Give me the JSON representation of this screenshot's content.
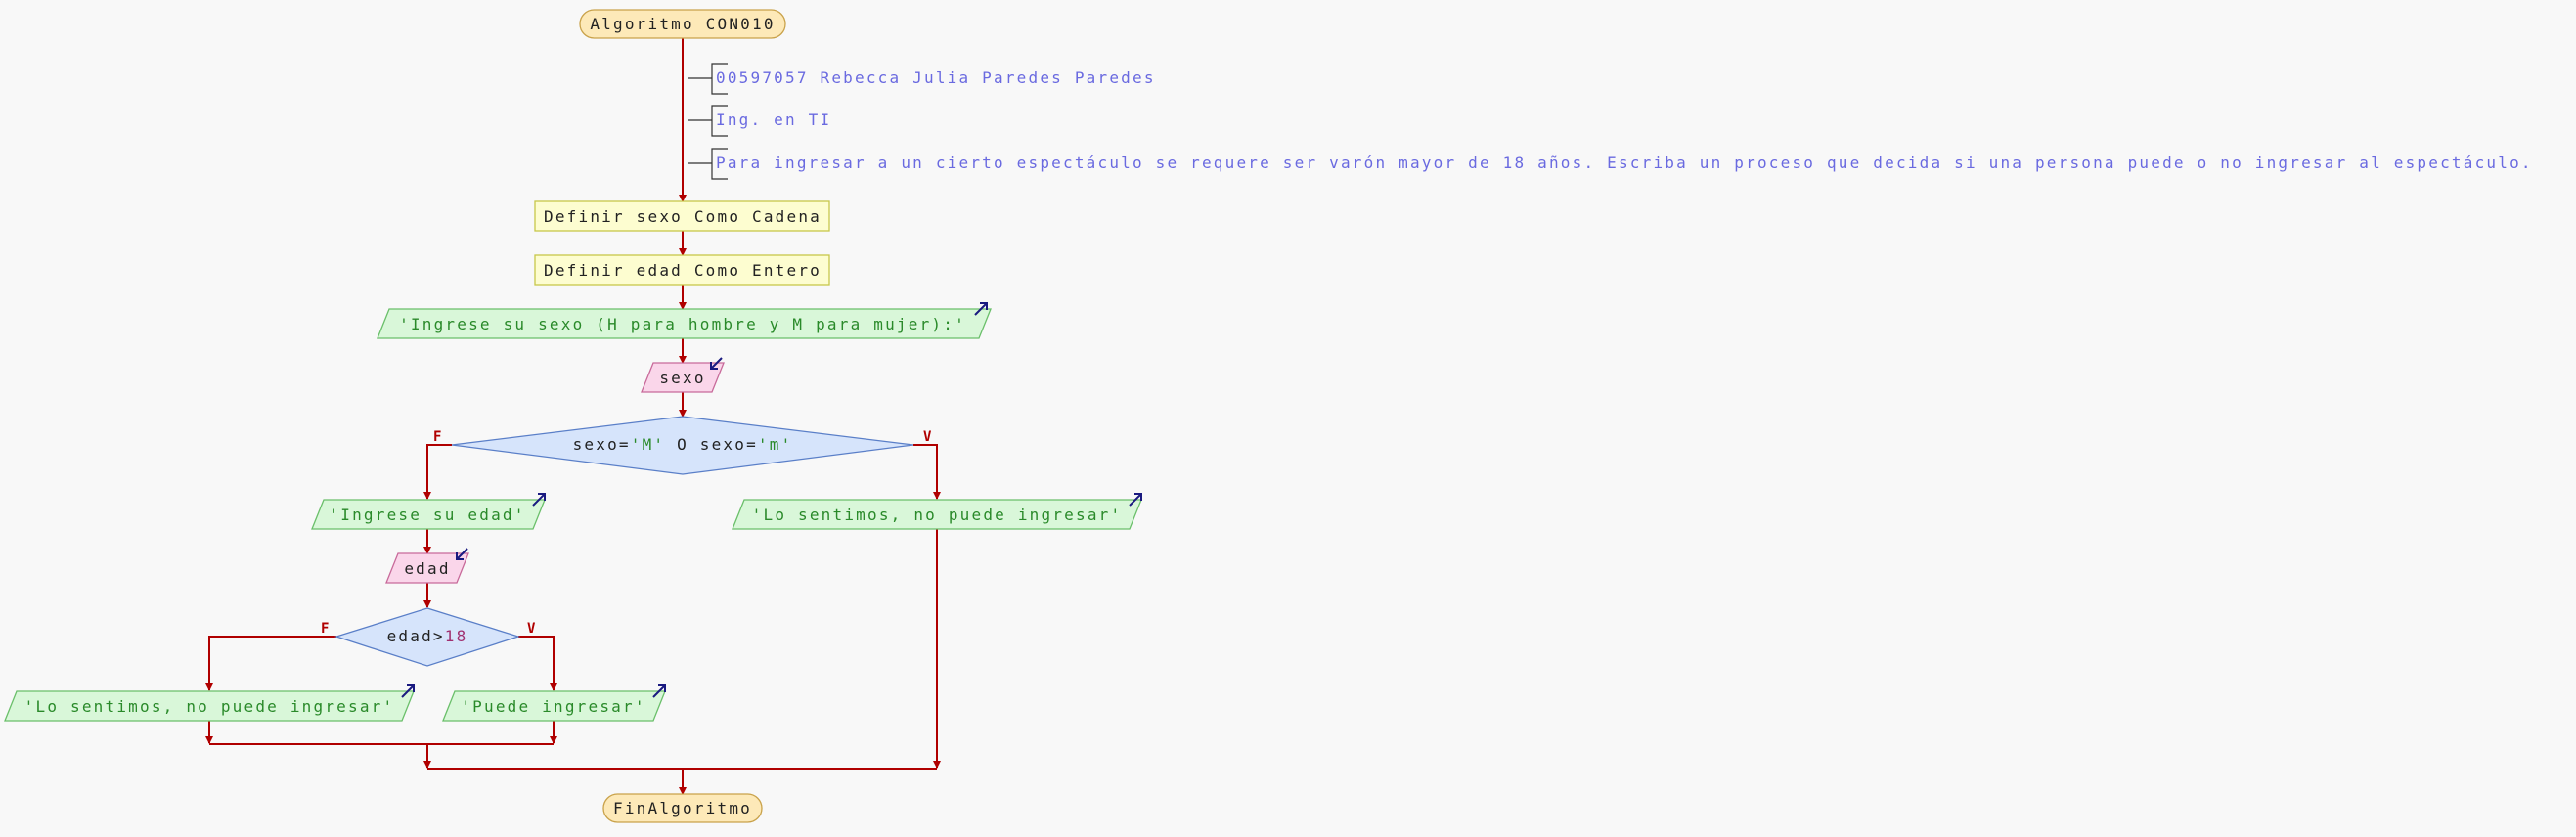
{
  "algorithm": {
    "start": "Algoritmo CON010",
    "end": "FinAlgoritmo"
  },
  "comments": [
    "00597057 Rebecca Julia Paredes Paredes",
    "Ing. en TI",
    "Para ingresar a un cierto espectáculo se requere ser varón mayor de 18 años. Escriba un proceso que decida si una persona puede o no ingresar al espectáculo."
  ],
  "definitions": [
    "Definir sexo Como Cadena",
    "Definir edad Como Entero"
  ],
  "io": {
    "prompt_sexo": "'Ingrese su sexo (H para hombre y M para mujer):'",
    "read_sexo": "sexo",
    "prompt_edad": "'Ingrese su edad'",
    "read_edad": "edad",
    "msg_no_1": "'Lo sentimos, no puede ingresar'",
    "msg_no_2": "'Lo sentimos, no puede ingresar'",
    "msg_yes": "'Puede ingresar'"
  },
  "decisions": {
    "sexo": {
      "var1": "sexo=",
      "lit1": "'M'",
      "op": " O ",
      "var2": "sexo=",
      "lit2": "'m'"
    },
    "edad": {
      "var": "edad>",
      "num": "18"
    }
  },
  "branch_labels": {
    "false": "F",
    "true": "V"
  },
  "colors": {
    "line": "#b00000",
    "terminal_fill": "#fde9b8",
    "terminal_stroke": "#c9a24a",
    "define_fill": "#fdfdd0",
    "define_stroke": "#c8c84a",
    "output_fill": "#d9f7d9",
    "output_stroke": "#6abf6a",
    "input_fill": "#fad6ea",
    "input_stroke": "#c86a9a",
    "decision_fill": "#d6e4fb",
    "decision_stroke": "#5a7fc8",
    "comment_text": "#6a6ae0",
    "output_text": "#2a8a2a",
    "string_literal": "#2a8a2a",
    "number_literal": "#a03070",
    "arrow_icon": "#1a1a80"
  }
}
